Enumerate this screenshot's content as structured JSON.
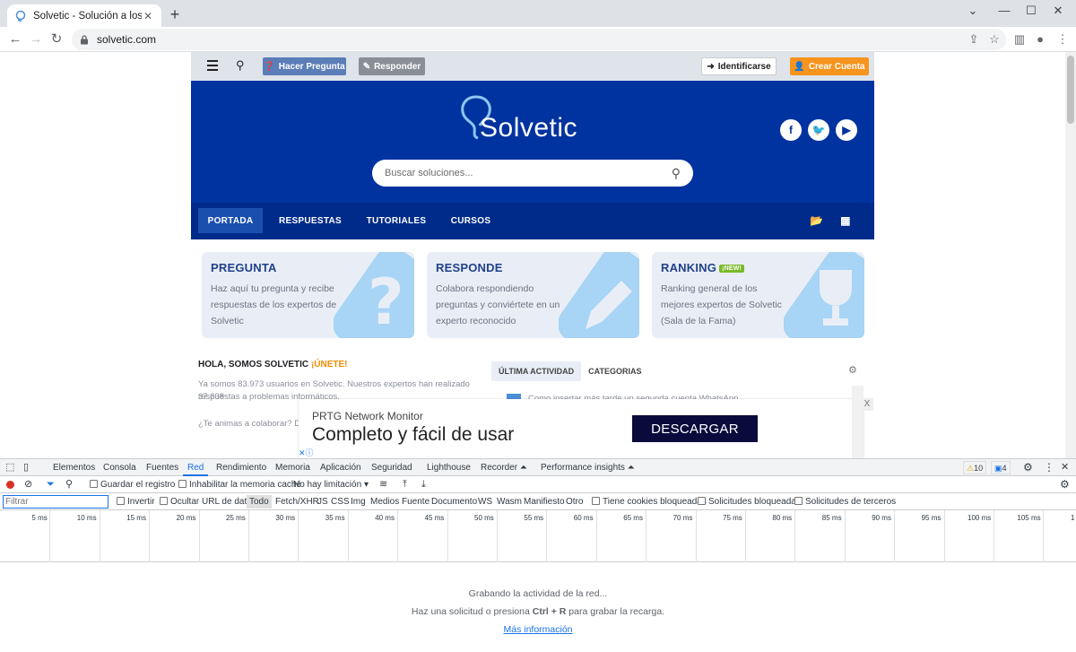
{
  "browser": {
    "tab_title": "Solvetic - Solución a los problem",
    "url": "solvetic.com"
  },
  "site": {
    "topbar": {
      "ask_label": "Hacer Pregunta",
      "answer_label": "Responder",
      "login_label": "Identificarse",
      "register_label": "Crear Cuenta"
    },
    "logo_text": "Solvetic",
    "search_placeholder": "Buscar soluciones...",
    "nav": [
      "PORTADA",
      "RESPUESTAS",
      "TUTORIALES",
      "CURSOS"
    ],
    "cards": [
      {
        "title": "PREGUNTA",
        "desc": "Haz aquí tu pregunta y recibe respuestas de los expertos de Solvetic"
      },
      {
        "title": "RESPONDE",
        "desc": "Colabora respondiendo preguntas y conviértete en un experto reconocido"
      },
      {
        "title": "RANKING",
        "badge": "¡NEW!",
        "desc": "Ranking general de los mejores expertos de Solvetic (Sala de la Fama)"
      }
    ],
    "hola_prefix": "HOLA, SOMOS SOLVETIC ",
    "hola_join": "¡ÚNETE!",
    "intro_line1": "Ya somos 83.973 usuarios en Solvetic. Nuestros expertos han realizado 37.638",
    "intro_line2": "respuestas a problemas informáticos.",
    "intro_line3": "¿Te animas a colaborar? De",
    "activity_tabs": [
      "ÚLTIMA ACTIVIDAD",
      "CATEGORIAS"
    ],
    "activity_item": "Como insertar más tarde un segunda cuenta WhatsApp",
    "ad": {
      "brand": "PRTG Network Monitor",
      "headline": "Completo y fácil de usar",
      "cta": "DESCARGAR",
      "close": "X"
    }
  },
  "devtools": {
    "tabs": [
      "Elementos",
      "Consola",
      "Fuentes",
      "Red",
      "Rendimiento",
      "Memoria",
      "Aplicación",
      "Seguridad",
      "Lighthouse",
      "Recorder",
      "Performance insights"
    ],
    "warnings": "10",
    "messages": "4",
    "preserve_log": "Guardar el registro",
    "disable_cache": "Inhabilitar la memoria caché",
    "throttling": "No hay limitación",
    "filter_placeholder": "Filtrar",
    "invert": "Invertir",
    "hide_data_urls": "Ocultar URL de datos",
    "type_filters": [
      "Todo",
      "Fetch/XHR",
      "JS",
      "CSS",
      "Img",
      "Medios",
      "Fuente",
      "Documento",
      "WS",
      "Wasm",
      "Manifiesto",
      "Otro"
    ],
    "blocked_cookies": "Tiene cookies bloqueadas",
    "blocked_requests": "Solicitudes bloqueadas",
    "third_party": "Solicitudes de terceros",
    "timeline_ticks": [
      "5 ms",
      "10 ms",
      "15 ms",
      "20 ms",
      "25 ms",
      "30 ms",
      "35 ms",
      "40 ms",
      "45 ms",
      "50 ms",
      "55 ms",
      "60 ms",
      "65 ms",
      "70 ms",
      "75 ms",
      "80 ms",
      "85 ms",
      "90 ms",
      "95 ms",
      "100 ms",
      "105 ms",
      "1"
    ],
    "recording": "Grabando la actividad de la red...",
    "hint_prefix": "Haz una solicitud o presiona ",
    "hint_keys": "Ctrl + R",
    "hint_suffix": " para grabar la recarga.",
    "more_info": "Más información"
  },
  "colors": {
    "hero": "#0033a0",
    "nav": "#002b8a",
    "accent_orange": "#f7941d",
    "link_blue": "#1a73e8"
  }
}
